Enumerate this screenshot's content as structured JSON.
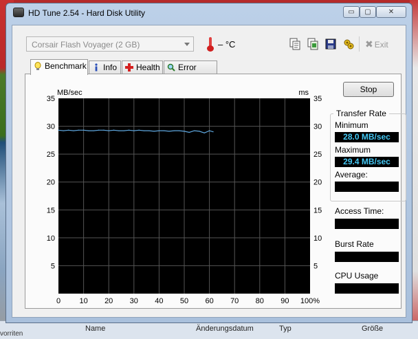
{
  "window": {
    "title": "HD Tune 2.54 - Hard Disk Utility",
    "controls": {
      "minimize": "▭",
      "restore": "▢",
      "close": "✕"
    }
  },
  "toolbar": {
    "drive": "Corsair Flash Voyager (2 GB)",
    "temperature": "– °C",
    "exit_label": "Exit"
  },
  "tabs": [
    {
      "label": "Benchmark",
      "icon": "lightbulb-icon",
      "active": true
    },
    {
      "label": "Info",
      "icon": "info-icon",
      "active": false
    },
    {
      "label": "Health",
      "icon": "health-cross-icon",
      "active": false
    },
    {
      "label": "Error Scan",
      "icon": "magnifier-icon",
      "active": false
    }
  ],
  "benchmark": {
    "stop_label": "Stop",
    "transfer_rate_title": "Transfer Rate",
    "minimum_label": "Minimum",
    "minimum_value": "28.0 MB/sec",
    "maximum_label": "Maximum",
    "maximum_value": "29.4 MB/sec",
    "average_label": "Average:",
    "average_value": "",
    "access_time_label": "Access Time:",
    "access_time_value": "",
    "burst_rate_label": "Burst Rate",
    "burst_rate_value": "",
    "cpu_usage_label": "CPU Usage",
    "cpu_usage_value": ""
  },
  "chart_data": {
    "type": "line",
    "ylabel_left": "MB/sec",
    "ylabel_right": "ms",
    "ylim": [
      0,
      35
    ],
    "yticks": [
      5,
      10,
      15,
      20,
      25,
      30,
      35
    ],
    "xticks": [
      "0",
      "10",
      "20",
      "30",
      "40",
      "50",
      "60",
      "70",
      "80",
      "90",
      "100%"
    ],
    "xlim": [
      0,
      100
    ],
    "background": "#000000",
    "grid_color": "#555555",
    "series": [
      {
        "color": "#5fa8e0",
        "x": [
          0,
          2,
          4,
          6,
          8,
          10,
          12,
          14,
          16,
          18,
          20,
          22,
          24,
          26,
          28,
          30,
          32,
          34,
          36,
          38,
          40,
          42,
          44,
          46,
          48,
          50,
          52,
          54,
          56,
          58,
          60,
          61.5
        ],
        "y": [
          29.3,
          29.2,
          29.3,
          29.2,
          29.3,
          29.3,
          29.2,
          29.2,
          29.3,
          29.3,
          29.2,
          29.3,
          29.2,
          29.2,
          29.3,
          29.2,
          29.3,
          29.2,
          29.2,
          29.1,
          29.2,
          29.2,
          29.1,
          29.2,
          29.2,
          29.1,
          28.9,
          29.2,
          29.1,
          28.8,
          29.2,
          29.0
        ]
      }
    ]
  },
  "background_window": {
    "columns": [
      "Name",
      "Änderungsdatum",
      "Typ",
      "Größe"
    ],
    "left_text": "vorriten"
  }
}
